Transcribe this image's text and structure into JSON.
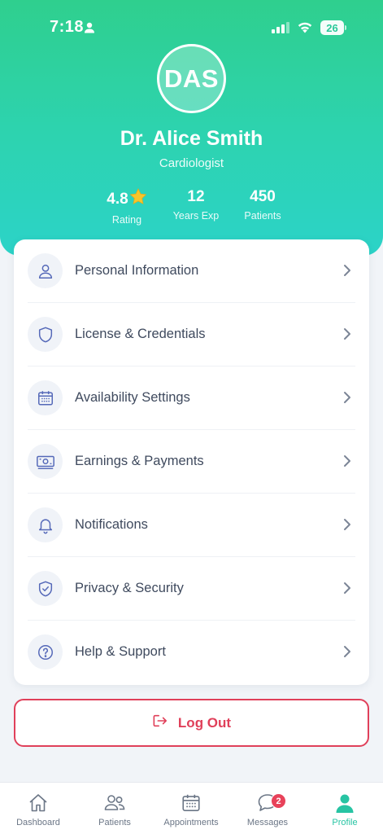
{
  "status_bar": {
    "time": "7:18",
    "battery": "26"
  },
  "profile": {
    "initials": "DAS",
    "name": "Dr. Alice Smith",
    "specialty": "Cardiologist",
    "stats": [
      {
        "value": "4.8",
        "label": "Rating"
      },
      {
        "value": "12",
        "label": "Years Exp"
      },
      {
        "value": "450",
        "label": "Patients"
      }
    ]
  },
  "menu": {
    "items": [
      {
        "label": "Personal Information",
        "icon": "user-icon"
      },
      {
        "label": "License & Credentials",
        "icon": "shield-icon"
      },
      {
        "label": "Availability Settings",
        "icon": "calendar-icon"
      },
      {
        "label": "Earnings & Payments",
        "icon": "money-icon"
      },
      {
        "label": "Notifications",
        "icon": "bell-icon"
      },
      {
        "label": "Privacy & Security",
        "icon": "shield-check-icon"
      },
      {
        "label": "Help & Support",
        "icon": "help-icon"
      }
    ]
  },
  "logout": {
    "label": "Log Out"
  },
  "tabbar": {
    "tabs": [
      {
        "label": "Dashboard",
        "icon": "home-icon"
      },
      {
        "label": "Patients",
        "icon": "users-icon"
      },
      {
        "label": "Appointments",
        "icon": "calendar-icon"
      },
      {
        "label": "Messages",
        "icon": "chat-icon"
      },
      {
        "label": "Profile",
        "icon": "profile-icon"
      }
    ],
    "messages_badge": "2",
    "active_tab": "Profile"
  },
  "colors": {
    "accent": "#27c4a3",
    "header_gradient_top": "#2fcf8e",
    "header_gradient_bottom": "#2cd3c8",
    "danger": "#e0405a",
    "icon": "#5468b8"
  }
}
